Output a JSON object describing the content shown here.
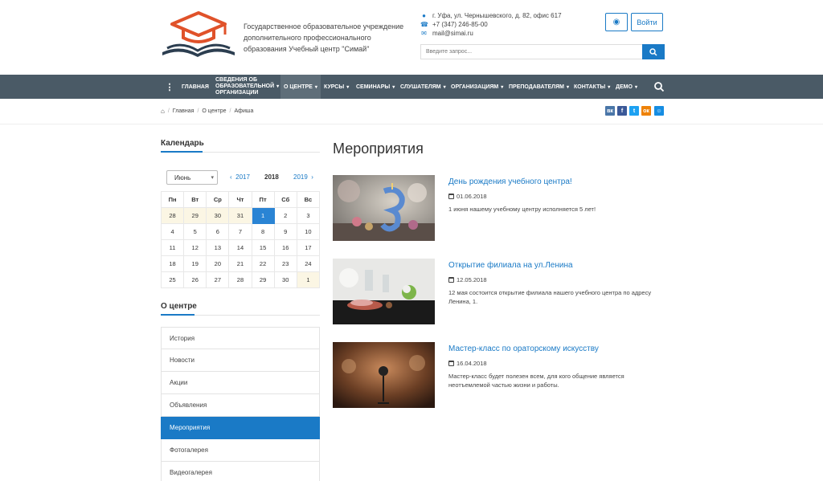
{
  "header": {
    "org_name": "Государственное образовательное учреждение дополнительного профессионального образования Учебный центр \"Симай\"",
    "address": "г. Уфа, ул. Чернышевского, д. 82, офис 617",
    "phone": "+7 (347) 246-85-00",
    "email": "mail@simai.ru",
    "login_label": "Войти",
    "search_placeholder": "Введите запрос..."
  },
  "nav": {
    "items": [
      {
        "label": "ГЛАВНАЯ"
      },
      {
        "label_lines": [
          "СВЕДЕНИЯ ОБ",
          "ОБРАЗОВАТЕЛЬНОЙ",
          "ОРГАНИЗАЦИИ"
        ]
      },
      {
        "label": "О ЦЕНТРЕ"
      },
      {
        "label": "КУРСЫ"
      },
      {
        "label": "СЕМИНАРЫ"
      },
      {
        "label": "СЛУШАТЕЛЯМ"
      },
      {
        "label": "ОРГАНИЗАЦИЯМ"
      },
      {
        "label": "ПРЕПОДАВАТЕЛЯМ"
      },
      {
        "label": "КОНТАКТЫ"
      },
      {
        "label": "ДЕМО"
      }
    ]
  },
  "breadcrumb": [
    "Главная",
    "О центре",
    "Афиша"
  ],
  "share": [
    {
      "label": "вк",
      "color": "#4a76a8"
    },
    {
      "label": "f",
      "color": "#3b5998"
    },
    {
      "label": "t",
      "color": "#1da1f2"
    },
    {
      "label": "ок",
      "color": "#ee8208"
    },
    {
      "label": "☺",
      "color": "#168de2"
    }
  ],
  "sidebar": {
    "calendar_title": "Календарь",
    "month": "Июнь",
    "year_prev": "2017",
    "year_current": "2018",
    "year_next": "2019",
    "weekdays": [
      "Пн",
      "Вт",
      "Ср",
      "Чт",
      "Пт",
      "Сб",
      "Вс"
    ],
    "weeks": [
      [
        "28",
        "29",
        "30",
        "31",
        "1",
        "2",
        "3"
      ],
      [
        "4",
        "5",
        "6",
        "7",
        "8",
        "9",
        "10"
      ],
      [
        "11",
        "12",
        "13",
        "14",
        "15",
        "16",
        "17"
      ],
      [
        "18",
        "19",
        "20",
        "21",
        "22",
        "23",
        "24"
      ],
      [
        "25",
        "26",
        "27",
        "28",
        "29",
        "30",
        "1"
      ]
    ],
    "about_title": "О центре",
    "menu": [
      "История",
      "Новости",
      "Акции",
      "Объявления",
      "Мероприятия",
      "Фотогалерея",
      "Видеогалерея"
    ],
    "menu_active": "Мероприятия"
  },
  "main": {
    "title": "Мероприятия",
    "events": [
      {
        "title": "День рождения учебного центра!",
        "date": "01.06.2018",
        "desc": "1 июня нашему учебному центру исполняется 5 лет!"
      },
      {
        "title": "Открытие филиала на ул.Ленина",
        "date": "12.05.2018",
        "desc": "12 мая состоится открытие филиала нашего учебного центра по адресу Ленина, 1."
      },
      {
        "title": "Мастер-класс по ораторскому искусству",
        "date": "16.04.2018",
        "desc": "Мастер-класс будет полезен всем, для кого общение является неотъемлемой частью жизни и работы."
      }
    ]
  },
  "colors": {
    "accent": "#1a7ac6",
    "nav_bg": "#4a5a66",
    "logo_orange": "#e0522a",
    "logo_dark": "#2c3e50"
  }
}
